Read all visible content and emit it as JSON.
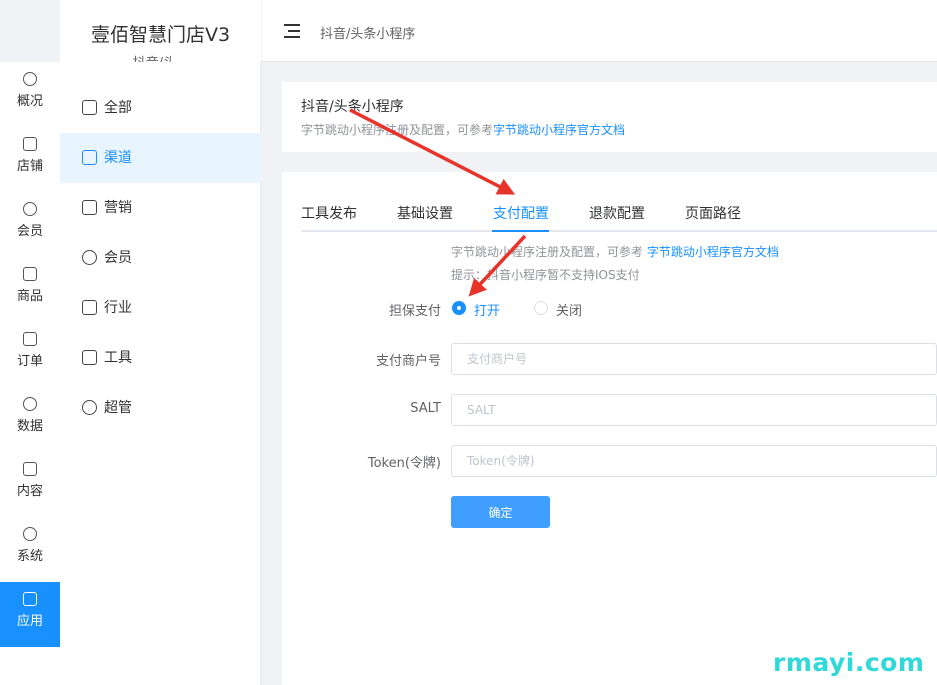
{
  "app": {
    "title": "壹佰智慧门店V3",
    "store_name": "抖音/头..."
  },
  "header": {
    "breadcrumb": "抖音/头条小程序"
  },
  "left_rail": {
    "items": [
      {
        "label": "概况",
        "icon": "dashboard-icon"
      },
      {
        "label": "店铺",
        "icon": "store-icon"
      },
      {
        "label": "会员",
        "icon": "user-icon"
      },
      {
        "label": "商品",
        "icon": "box-icon"
      },
      {
        "label": "订单",
        "icon": "clipboard-icon"
      },
      {
        "label": "数据",
        "icon": "pie-chart-icon"
      },
      {
        "label": "内容",
        "icon": "folder-icon"
      },
      {
        "label": "系统",
        "icon": "gear-icon"
      },
      {
        "label": "应用",
        "icon": "cube-icon",
        "active": true
      }
    ]
  },
  "submenu": {
    "items": [
      {
        "label": "全部",
        "icon": "cube-icon"
      },
      {
        "label": "渠道",
        "icon": "channel-icon",
        "active": true
      },
      {
        "label": "营销",
        "icon": "monitor-icon"
      },
      {
        "label": "会员",
        "icon": "user-icon"
      },
      {
        "label": "行业",
        "icon": "briefcase-icon"
      },
      {
        "label": "工具",
        "icon": "wrench-icon"
      },
      {
        "label": "超管",
        "icon": "admin-icon"
      }
    ]
  },
  "intro": {
    "title": "抖音/头条小程序",
    "desc_prefix": "字节跳动小程序注册及配置，可参考",
    "desc_link": "字节跳动小程序官方文档"
  },
  "tabs": [
    {
      "label": "工具发布"
    },
    {
      "label": "基础设置"
    },
    {
      "label": "支付配置",
      "active": true
    },
    {
      "label": "退款配置"
    },
    {
      "label": "页面路径"
    }
  ],
  "form": {
    "tip_prefix": "字节跳动小程序注册及配置，可参考 ",
    "tip_link": "字节跳动小程序官方文档",
    "tip_note": "提示：抖音小程序暂不支持IOS支付",
    "escrow": {
      "label": "担保支付",
      "on_label": "打开",
      "off_label": "关闭",
      "value": "打开"
    },
    "merchant_id": {
      "label": "支付商户号",
      "placeholder": "支付商户号",
      "value": ""
    },
    "salt": {
      "label": "SALT",
      "placeholder": "SALT",
      "value": ""
    },
    "token": {
      "label": "Token(令牌)",
      "placeholder": "Token(令牌)",
      "value": ""
    },
    "submit_label": "确定"
  },
  "watermark": "rmayi.com",
  "colors": {
    "primary": "#1890ff",
    "button": "#409eff",
    "arrow": "#e8332a",
    "watermark": "#30d8d8"
  }
}
